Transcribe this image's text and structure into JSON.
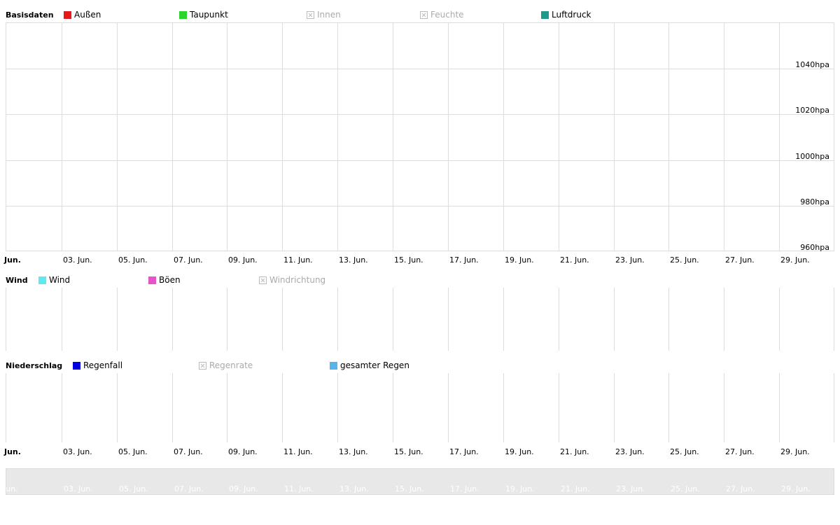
{
  "charts": {
    "basis": {
      "title": "Basisdaten",
      "legend": [
        {
          "label": "Außen",
          "color": "#e31a1c",
          "enabled": true
        },
        {
          "label": "Taupunkt",
          "color": "#2bd52b",
          "enabled": true
        },
        {
          "label": "Innen",
          "color": "#bbbbbb",
          "enabled": false
        },
        {
          "label": "Feuchte",
          "color": "#bbbbbb",
          "enabled": false
        },
        {
          "label": "Luftdruck",
          "color": "#1f9a8a",
          "enabled": true
        }
      ],
      "y_ticks": [
        "1040hpa",
        "1020hpa",
        "1000hpa",
        "980hpa",
        "960hpa"
      ]
    },
    "wind": {
      "title": "Wind",
      "legend": [
        {
          "label": "Wind",
          "color": "#5ee8f0",
          "enabled": true
        },
        {
          "label": "Böen",
          "color": "#e654c8",
          "enabled": true
        },
        {
          "label": "Windrichtung",
          "color": "#bbbbbb",
          "enabled": false
        }
      ]
    },
    "rain": {
      "title": "Niederschlag",
      "legend": [
        {
          "label": "Regenfall",
          "color": "#0000e0",
          "enabled": true
        },
        {
          "label": "Regenrate",
          "color": "#bbbbbb",
          "enabled": false
        },
        {
          "label": "gesamter Regen",
          "color": "#5ab4ec",
          "enabled": true
        }
      ]
    }
  },
  "x_ticks": [
    "Jun.",
    "03. Jun.",
    "05. Jun.",
    "07. Jun.",
    "09. Jun.",
    "11. Jun.",
    "13. Jun.",
    "15. Jun.",
    "17. Jun.",
    "19. Jun.",
    "21. Jun.",
    "23. Jun.",
    "25. Jun.",
    "27. Jun.",
    "29. Jun."
  ],
  "chart_data": [
    {
      "type": "line",
      "title": "Basisdaten",
      "categories": [
        "Jun.",
        "03. Jun.",
        "05. Jun.",
        "07. Jun.",
        "09. Jun.",
        "11. Jun.",
        "13. Jun.",
        "15. Jun.",
        "17. Jun.",
        "19. Jun.",
        "21. Jun.",
        "23. Jun.",
        "25. Jun.",
        "27. Jun.",
        "29. Jun."
      ],
      "series": [
        {
          "name": "Außen",
          "values": []
        },
        {
          "name": "Taupunkt",
          "values": []
        },
        {
          "name": "Innen",
          "values": []
        },
        {
          "name": "Feuchte",
          "values": []
        },
        {
          "name": "Luftdruck",
          "values": []
        }
      ],
      "ylim": [
        950,
        1060
      ],
      "y_ticks": [
        "1040hpa",
        "1020hpa",
        "1000hpa",
        "980hpa",
        "960hpa"
      ],
      "grid": true,
      "legend": "top"
    },
    {
      "type": "line",
      "title": "Wind",
      "categories": [
        "Jun.",
        "03. Jun.",
        "05. Jun.",
        "07. Jun.",
        "09. Jun.",
        "11. Jun.",
        "13. Jun.",
        "15. Jun.",
        "17. Jun.",
        "19. Jun.",
        "21. Jun.",
        "23. Jun.",
        "25. Jun.",
        "27. Jun.",
        "29. Jun."
      ],
      "series": [
        {
          "name": "Wind",
          "values": []
        },
        {
          "name": "Böen",
          "values": []
        },
        {
          "name": "Windrichtung",
          "values": []
        }
      ],
      "grid": true,
      "legend": "top"
    },
    {
      "type": "line",
      "title": "Niederschlag",
      "categories": [
        "Jun.",
        "03. Jun.",
        "05. Jun.",
        "07. Jun.",
        "09. Jun.",
        "11. Jun.",
        "13. Jun.",
        "15. Jun.",
        "17. Jun.",
        "19. Jun.",
        "21. Jun.",
        "23. Jun.",
        "25. Jun.",
        "27. Jun.",
        "29. Jun."
      ],
      "series": [
        {
          "name": "Regenfall",
          "values": []
        },
        {
          "name": "Regenrate",
          "values": []
        },
        {
          "name": "gesamter Regen",
          "values": []
        }
      ],
      "grid": true,
      "legend": "top"
    }
  ]
}
